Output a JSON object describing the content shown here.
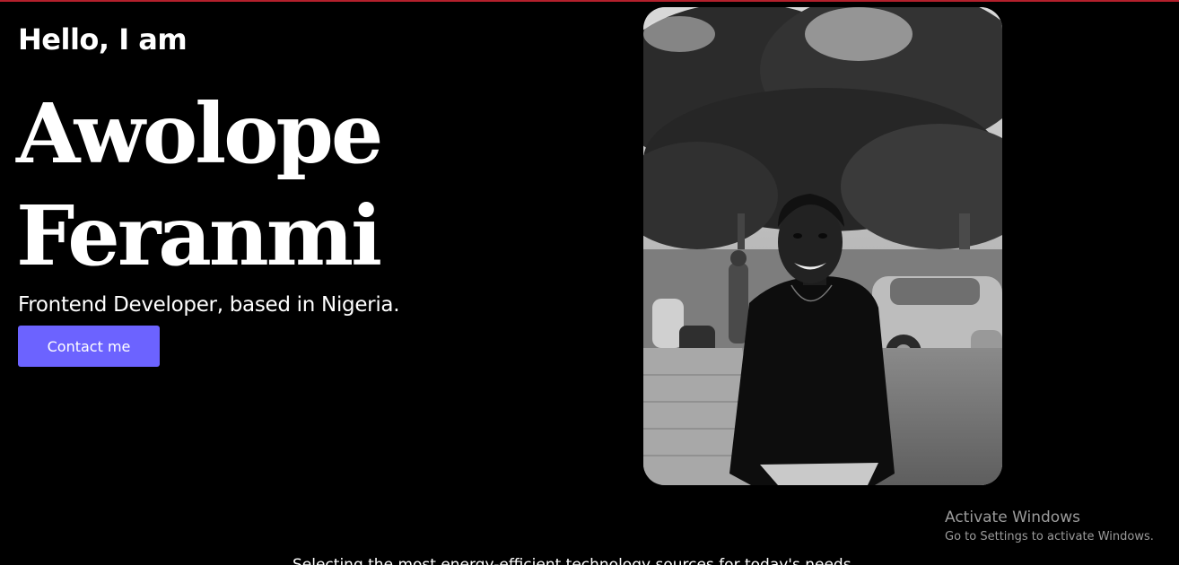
{
  "hero": {
    "greeting": "Hello, I am",
    "name_line1": "Awolope",
    "name_line2": "Feranmi",
    "tagline": "Frontend Developer, based in Nigeria.",
    "contact_label": "Contact me"
  },
  "photo": {
    "alt": "Black and white portrait of Awolope Feranmi smiling in front of trees"
  },
  "watermark": {
    "title": "Activate Windows",
    "subtitle": "Go to Settings to activate Windows."
  },
  "bottom": {
    "text": "Selecting the most energy-efficient technology sources for today's needs"
  },
  "colors": {
    "background": "#000000",
    "accent": "#6c63ff",
    "top_border": "#b3202c"
  }
}
